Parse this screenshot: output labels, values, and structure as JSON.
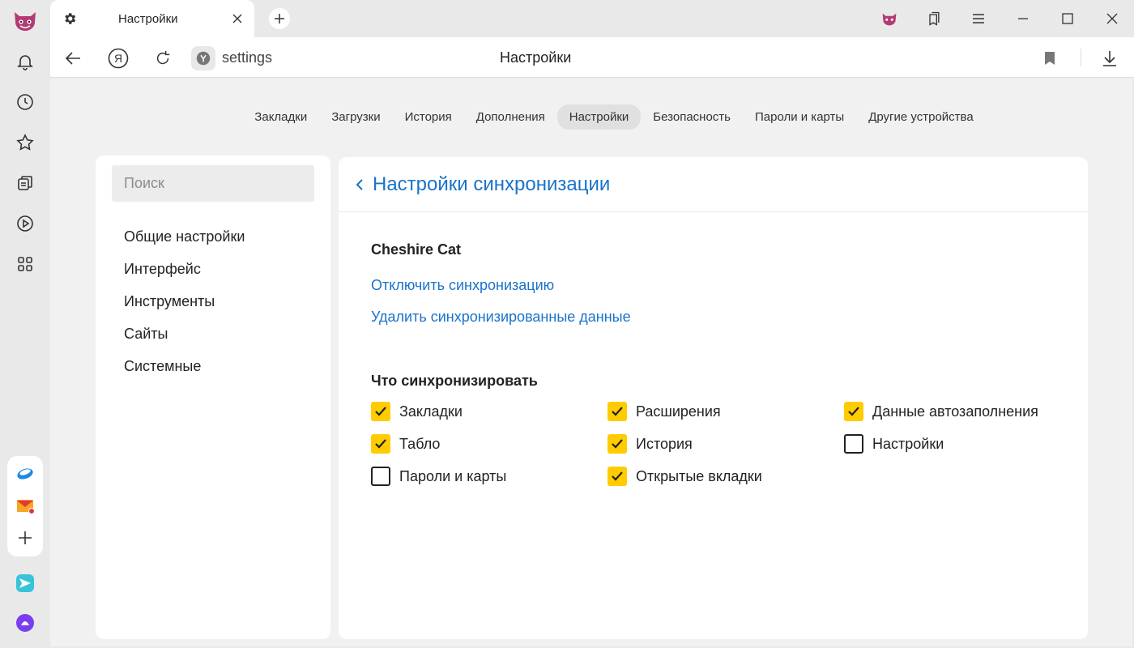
{
  "browser": {
    "tab": {
      "title": "Настройки"
    },
    "address": {
      "url": "settings",
      "page_title": "Настройки"
    }
  },
  "sidebar": {
    "icons": [
      "bell-icon",
      "clock-icon",
      "star-icon",
      "collections-icon",
      "play-icon",
      "apps-icon"
    ],
    "services": [
      "disk-icon",
      "mail-icon",
      "add-icon"
    ],
    "bottom": [
      "messenger-icon",
      "alice-icon"
    ]
  },
  "topnav": {
    "items": [
      {
        "label": "Закладки"
      },
      {
        "label": "Загрузки"
      },
      {
        "label": "История"
      },
      {
        "label": "Дополнения"
      },
      {
        "label": "Настройки"
      },
      {
        "label": "Безопасность"
      },
      {
        "label": "Пароли и карты"
      },
      {
        "label": "Другие устройства"
      }
    ],
    "active_index": 4
  },
  "left_panel": {
    "search_placeholder": "Поиск",
    "menu": [
      {
        "label": "Общие настройки"
      },
      {
        "label": "Интерфейс"
      },
      {
        "label": "Инструменты"
      },
      {
        "label": "Сайты"
      },
      {
        "label": "Системные"
      }
    ]
  },
  "main": {
    "title": "Настройки синхронизации",
    "account_name": "Cheshire Cat",
    "links": {
      "disable_sync": "Отключить синхронизацию",
      "delete_data": "Удалить синхронизированные данные"
    },
    "section_title": "Что синхронизировать",
    "options": [
      {
        "label": "Закладки",
        "checked": true
      },
      {
        "label": "Расширения",
        "checked": true
      },
      {
        "label": "Данные автозаполнения",
        "checked": true
      },
      {
        "label": "Табло",
        "checked": true
      },
      {
        "label": "История",
        "checked": true
      },
      {
        "label": "Настройки",
        "checked": false
      },
      {
        "label": "Пароли и карты",
        "checked": false
      },
      {
        "label": "Открытые вкладки",
        "checked": true
      }
    ]
  },
  "colors": {
    "accent": "#1a73c8",
    "check": "#ffcc00"
  }
}
